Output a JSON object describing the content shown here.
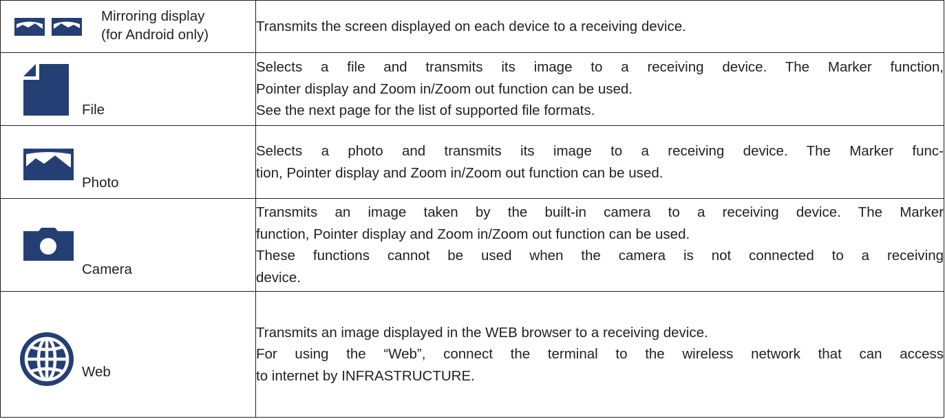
{
  "accent_color": "#243f73",
  "rows": [
    {
      "icon": "mirroring-display-icon",
      "label_lines": [
        "Mirroring display",
        "(for Android only)"
      ],
      "desc_lines": [
        "Transmits the screen displayed on each device to a receiving device."
      ]
    },
    {
      "icon": "file-icon",
      "label": "File",
      "desc_lines": [
        "Selects a file and transmits its image to a receiving device. The Marker function,",
        "Pointer display and Zoom in/Zoom out function can be used.",
        "See the next page for the list of supported file formats."
      ]
    },
    {
      "icon": "photo-icon",
      "label": "Photo",
      "desc_lines": [
        "Selects a photo and transmits its image to a receiving device. The Marker func-",
        "tion, Pointer display and Zoom in/Zoom out function can be used."
      ]
    },
    {
      "icon": "camera-icon",
      "label": "Camera",
      "desc_lines": [
        "Transmits an image taken by the built-in camera to a receiving device. The Marker",
        "function, Pointer display and Zoom in/Zoom out function can be used.",
        "These functions cannot be used when the camera is not connected to a receiving",
        "device."
      ]
    },
    {
      "icon": "globe-icon",
      "label": "Web",
      "desc_lines": [
        "Transmits an image displayed in the WEB browser to a receiving device.",
        "For using the “Web”, connect the terminal to the wireless network that can access",
        "to internet by INFRASTRUCTURE."
      ]
    }
  ]
}
